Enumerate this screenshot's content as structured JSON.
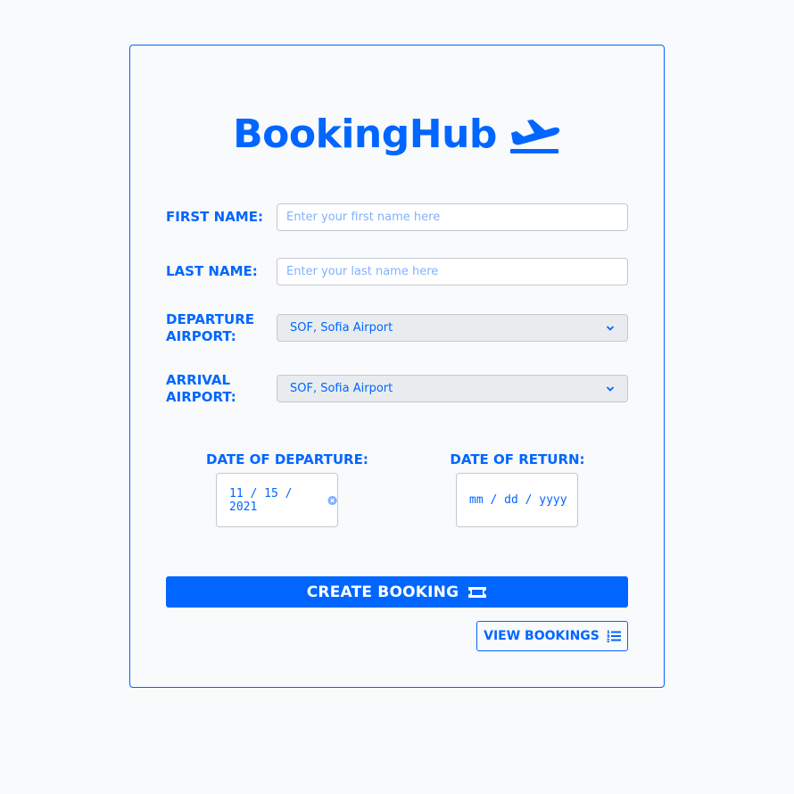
{
  "brand": {
    "title": "BookingHub",
    "icon": "plane-departure-icon"
  },
  "form": {
    "first_name": {
      "label": "FIRST NAME:",
      "placeholder": "Enter your first name here",
      "value": ""
    },
    "last_name": {
      "label": "LAST NAME:",
      "placeholder": "Enter your last name here",
      "value": ""
    },
    "departure_airport": {
      "label_line1": "DEPARTURE",
      "label_line2": "AIRPORT:",
      "selected": "SOF, Sofia Airport"
    },
    "arrival_airport": {
      "label_line1": "ARRIVAL",
      "label_line2": "AIRPORT:",
      "selected": "SOF, Sofia Airport"
    },
    "date_of_departure": {
      "label": "DATE OF DEPARTURE:",
      "value": "11 / 15 / 2021"
    },
    "date_of_return": {
      "label": "DATE OF RETURN:",
      "value": "mm / dd / yyyy"
    }
  },
  "actions": {
    "create_booking": {
      "label": "CREATE BOOKING",
      "icon": "ticket-icon"
    },
    "view_bookings": {
      "label": "VIEW BOOKINGS",
      "icon": "ordered-list-icon"
    }
  },
  "colors": {
    "accent": "#0066ff",
    "background": "#f8fafc",
    "select_bg": "#e9ecef"
  }
}
